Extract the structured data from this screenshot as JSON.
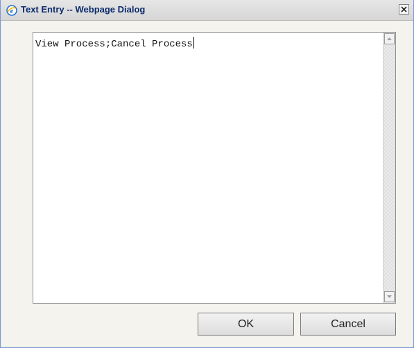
{
  "window": {
    "title": "Text Entry -- Webpage Dialog",
    "close_icon": "close-icon",
    "app_icon": "ie-icon"
  },
  "editor": {
    "value": "View Process;Cancel Process"
  },
  "buttons": {
    "ok_label": "OK",
    "cancel_label": "Cancel"
  },
  "colors": {
    "title_text": "#0b2b6b",
    "dialog_bg": "#f4f3ee",
    "ie_icon": "#1f6fd1"
  }
}
